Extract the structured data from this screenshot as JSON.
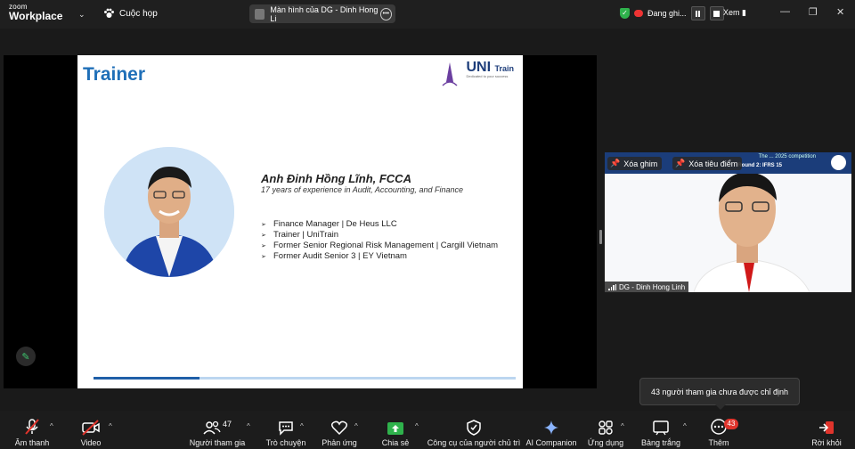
{
  "topbar": {
    "logo_line1": "zoom",
    "logo_line2": "Workplace",
    "meeting_label": "Cuộc họp",
    "share_label": "Màn hình của DG - Dinh Hong Li",
    "recording_label": "Đang ghi...",
    "view_label": "Xem"
  },
  "slide": {
    "title": "Trainer",
    "logo_text": "UNI",
    "logo_sub": "Train",
    "logo_tagline": "Dedicated to your success",
    "name": "Anh Đinh Hồng Lĩnh, FCCA",
    "experience": "17 years of experience in Audit, Accounting, and Finance",
    "bullets": [
      "Finance Manager | De Heus LLC",
      "Trainer | UniTrain",
      "Former Senior Regional Risk Management | Cargill Vietnam",
      "Former Audit Senior 3 | EY Vietnam"
    ],
    "progress_fraction": 0.25
  },
  "video": {
    "banner_line1": "The ... 2025 competition",
    "banner_line2": "Round 2: IFRS 15",
    "unpin_label": "Xóa ghim",
    "unspotlight_label": "Xóa tiêu điểm",
    "participant_name": "DG - Dinh Hong Linh"
  },
  "tooltip": "43 người tham gia chưa được chỉ định",
  "toolbar": {
    "audio": "Âm thanh",
    "video": "Video",
    "participants": "Người tham gia",
    "participants_count": "47",
    "chat": "Trò chuyện",
    "reactions": "Phản ứng",
    "share": "Chia sẻ",
    "host_tools": "Công cụ của người chủ trì",
    "ai_companion": "AI Companion",
    "apps": "Ứng dụng",
    "whiteboard": "Bảng trắng",
    "more": "Thêm",
    "more_badge": "43",
    "leave": "Rời khỏi"
  },
  "colors": {
    "accent_green": "#2fb24c",
    "slide_title_blue": "#1f6fb8",
    "leave_red": "#e0342c"
  }
}
